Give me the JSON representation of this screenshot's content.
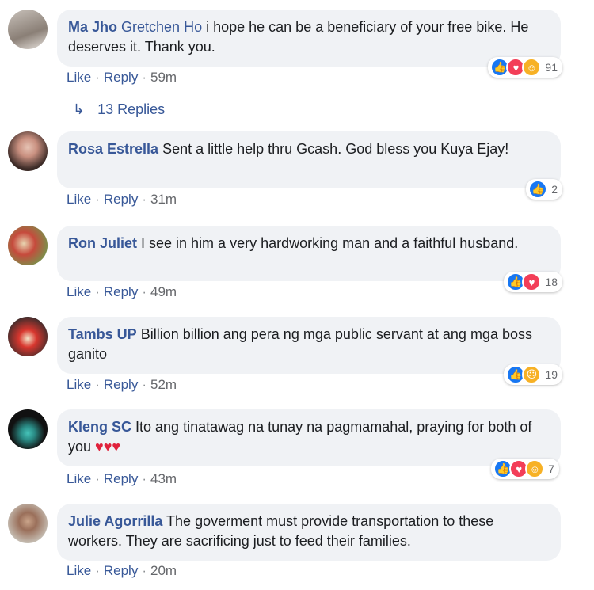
{
  "comments": [
    {
      "author": "Ma Jho",
      "mention": "Gretchen Ho",
      "text": " i hope he can be a beneficiary of your free bike. He deserves it. Thank you.",
      "reaction_count": "91",
      "reactions": [
        "like",
        "love",
        "care"
      ],
      "time": "59m"
    },
    {
      "author": "Rosa Estrella",
      "mention": "",
      "text": " Sent a little help thru Gcash. God bless you Kuya Ejay!",
      "reaction_count": "2",
      "reactions": [
        "like"
      ],
      "time": "31m"
    },
    {
      "author": "Ron Juliet",
      "mention": "",
      "text": " I see in him a very hardworking man and a faithful husband.",
      "reaction_count": "18",
      "reactions": [
        "like",
        "love"
      ],
      "time": "49m"
    },
    {
      "author": "Tambs UP",
      "mention": "",
      "text": " Billion billion ang pera ng mga public servant at ang mga boss ganito",
      "reaction_count": "19",
      "reactions": [
        "like",
        "sad"
      ],
      "time": "52m"
    },
    {
      "author": "Kleng SC",
      "mention": "",
      "text": " Ito ang tinatawag na tunay na pagmamahal, praying for both of you ",
      "hearts": "♥♥♥",
      "reaction_count": "7",
      "reactions": [
        "like",
        "love",
        "care"
      ],
      "time": "43m"
    },
    {
      "author": "Julie Agorrilla",
      "mention": "",
      "text": " The goverment must provide transportation to these workers. They are sacrificing just to feed their families.",
      "reaction_count": "",
      "reactions": [],
      "time": "20m"
    }
  ],
  "labels": {
    "like": "Like",
    "reply": "Reply",
    "dot": "·"
  },
  "replies_label": "13 Replies",
  "colors": {
    "link": "#385898",
    "bubble": "#f0f2f5",
    "like": "#1877f2",
    "love": "#f33e58",
    "care": "#f7b125"
  }
}
